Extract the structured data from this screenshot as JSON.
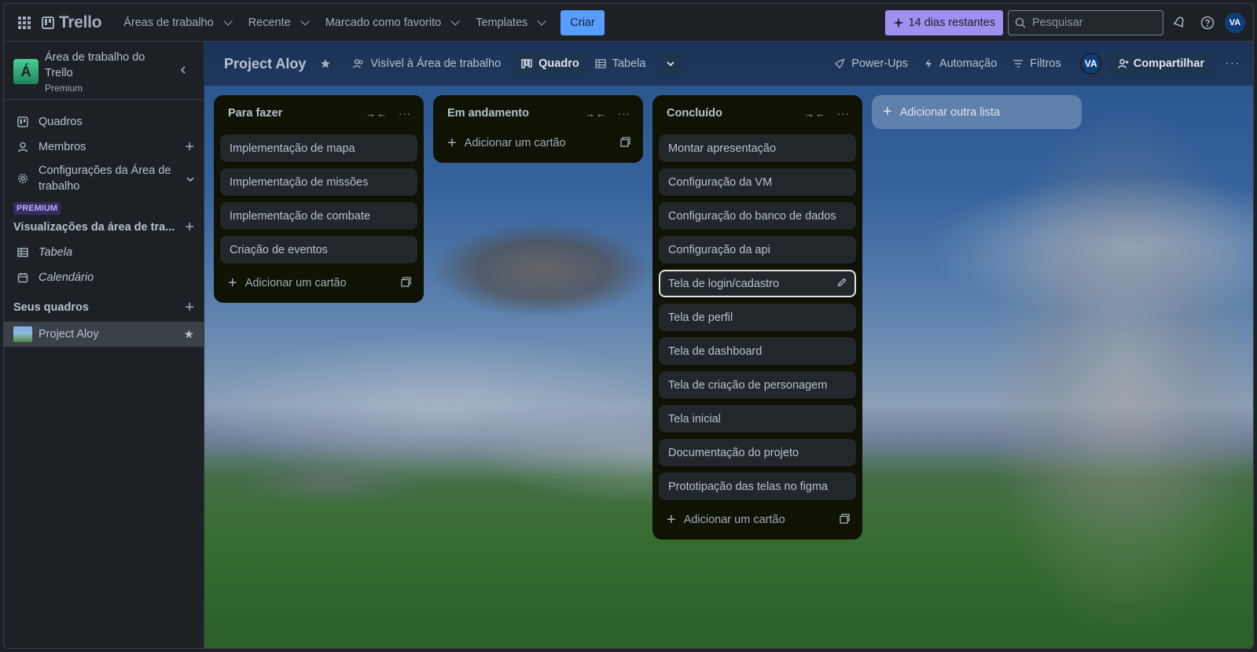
{
  "topnav": {
    "logo": "Trello",
    "menus": [
      "Áreas de trabalho",
      "Recente",
      "Marcado como favorito",
      "Templates"
    ],
    "create_label": "Criar",
    "trial_label": "14 dias restantes",
    "search_placeholder": "Pesquisar",
    "avatar_initials": "VA"
  },
  "sidebar": {
    "workspace_initial": "Á",
    "workspace_name": "Área de trabalho do Trello",
    "workspace_plan": "Premium",
    "items": [
      {
        "label": "Quadros",
        "icon": "board-icon"
      },
      {
        "label": "Membros",
        "icon": "person-icon"
      },
      {
        "label": "Configurações da Área de trabalho",
        "icon": "gear-icon"
      }
    ],
    "premium_badge": "PREMIUM",
    "views_section": "Visualizações da área de tra...",
    "views": [
      {
        "label": "Tabela",
        "icon": "table-icon"
      },
      {
        "label": "Calendário",
        "icon": "calendar-icon"
      }
    ],
    "boards_section": "Seus quadros",
    "boards": [
      {
        "label": "Project Aloy"
      }
    ]
  },
  "board": {
    "title": "Project Aloy",
    "visibility": "Visível à Área de trabalho",
    "view_active": "Quadro",
    "view_table": "Tabela",
    "powerups": "Power-Ups",
    "automation": "Automação",
    "filters": "Filtros",
    "avatar_initials": "VA",
    "share": "Compartilhar",
    "add_list": "Adicionar outra lista",
    "add_card": "Adicionar um cartão",
    "lists": [
      {
        "title": "Para fazer",
        "cards": [
          "Implementação de mapa",
          "Implementação de missões",
          "Implementação de combate",
          "Criação de eventos"
        ]
      },
      {
        "title": "Em andamento",
        "cards": []
      },
      {
        "title": "Concluído",
        "cards": [
          "Montar apresentação",
          "Configuração da VM",
          "Configuração do banco de dados",
          "Configuração da api",
          "Tela de login/cadastro",
          "Tela de perfil",
          "Tela de dashboard",
          "Tela de criação de personagem",
          "Tela inicial",
          "Documentação do projeto",
          "Prototipação das telas no figma"
        ]
      }
    ]
  },
  "colors": {
    "accent": "#579dff",
    "trial": "#9f8fef",
    "list_bg": "#101204",
    "card_bg": "#22272b"
  }
}
